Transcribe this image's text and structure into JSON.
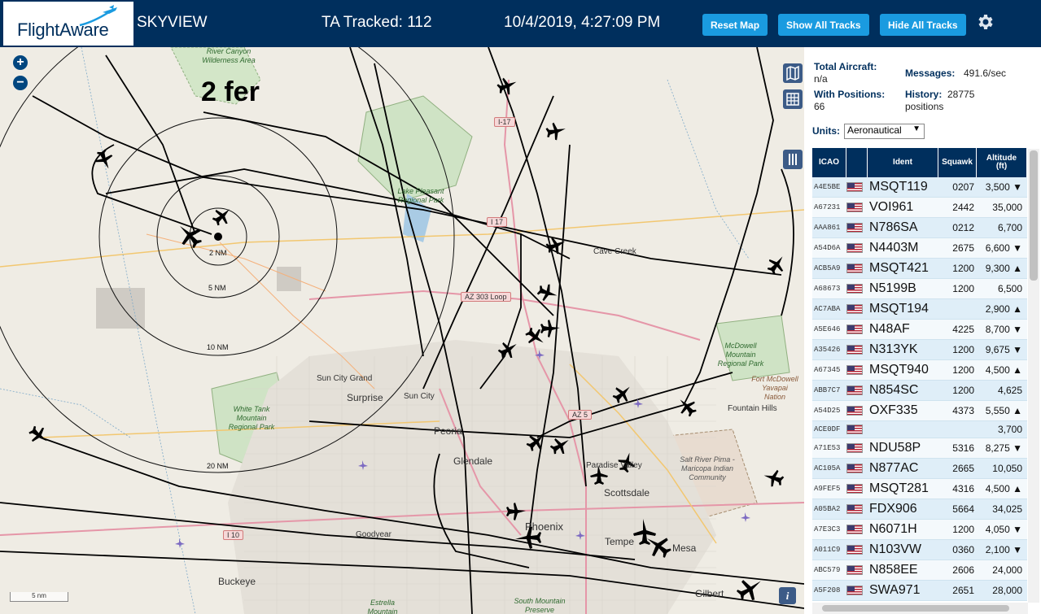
{
  "header": {
    "logo_text": "FlightAware",
    "app_name": "SKYVIEW",
    "tracked": "TA Tracked: 112",
    "clock": "10/4/2019, 4:27:09 PM",
    "buttons": {
      "reset_map": "Reset Map",
      "show_all": "Show All Tracks",
      "hide_all": "Hide All Tracks"
    }
  },
  "map": {
    "note": "2 fer",
    "zoom_in": "+",
    "zoom_out": "−",
    "scale": "5 nm",
    "info": "i",
    "ring_labels": [
      "2 NM",
      "5 NM",
      "10 NM",
      "20 NM"
    ],
    "place_labels": [
      "Sun City Grand",
      "Surprise",
      "Sun City",
      "Peoria",
      "Glendale",
      "Goodyear",
      "Buckeye",
      "Phoenix",
      "Scottsdale",
      "Paradise Valley",
      "Tempe",
      "Mesa",
      "Gilbert",
      "Fountain Hills",
      "Cave Creek",
      "Fort McDowell Yavapai Nation"
    ],
    "park_labels": [
      "Lake Pleasant Regional Park",
      "White Tank Mountain Regional Park",
      "McDowell Mountain Regional Park",
      "Salt River Pima - Maricopa Indian Community",
      "River Canyon Wilderness Area",
      "Estrella Mountain",
      "South Mountain Preserve"
    ],
    "road_labels": [
      "I-17",
      "I 17",
      "AZ 303 Loop",
      "AZ 5",
      "I 10"
    ]
  },
  "stats": {
    "total_label": "Total Aircraft:",
    "total_value": "n/a",
    "positions_label": "With Positions:",
    "positions_value": "66",
    "messages_label": "Messages:",
    "messages_value": "491.6/sec",
    "history_label": "History:",
    "history_value": "28775 positions"
  },
  "units": {
    "label": "Units:",
    "selected": "Aeronautical"
  },
  "table": {
    "headers": {
      "icao": "ICAO",
      "ident": "Ident",
      "squawk": "Squawk",
      "altitude": "Altitude (ft)"
    },
    "rows": [
      {
        "icao": "A4E5BE",
        "ident": "MSQT119",
        "squawk": "0207",
        "alt": "3,500 ▼"
      },
      {
        "icao": "A67231",
        "ident": "VOI961",
        "squawk": "2442",
        "alt": "35,000"
      },
      {
        "icao": "AAA861",
        "ident": "N786SA",
        "squawk": "0212",
        "alt": "6,700"
      },
      {
        "icao": "A54D6A",
        "ident": "N4403M",
        "squawk": "2675",
        "alt": "6,600 ▼"
      },
      {
        "icao": "ACB5A9",
        "ident": "MSQT421",
        "squawk": "1200",
        "alt": "9,300 ▲"
      },
      {
        "icao": "A68673",
        "ident": "N5199B",
        "squawk": "1200",
        "alt": "6,500"
      },
      {
        "icao": "AC7ABA",
        "ident": "MSQT194",
        "squawk": "",
        "alt": "2,900 ▲"
      },
      {
        "icao": "A5E646",
        "ident": "N48AF",
        "squawk": "4225",
        "alt": "8,700 ▼"
      },
      {
        "icao": "A35426",
        "ident": "N313YK",
        "squawk": "1200",
        "alt": "9,675 ▼"
      },
      {
        "icao": "A67345",
        "ident": "MSQT940",
        "squawk": "1200",
        "alt": "4,500 ▲"
      },
      {
        "icao": "ABB7C7",
        "ident": "N854SC",
        "squawk": "1200",
        "alt": "4,625"
      },
      {
        "icao": "A54D25",
        "ident": "OXF335",
        "squawk": "4373",
        "alt": "5,550 ▲"
      },
      {
        "icao": "ACE0DF",
        "ident": "",
        "squawk": "",
        "alt": "3,700"
      },
      {
        "icao": "A71E53",
        "ident": "NDU58P",
        "squawk": "5316",
        "alt": "8,275 ▼"
      },
      {
        "icao": "AC105A",
        "ident": "N877AC",
        "squawk": "2665",
        "alt": "10,050"
      },
      {
        "icao": "A9FEF5",
        "ident": "MSQT281",
        "squawk": "4316",
        "alt": "4,500 ▲"
      },
      {
        "icao": "A05BA2",
        "ident": "FDX906",
        "squawk": "5664",
        "alt": "34,025"
      },
      {
        "icao": "A7E3C3",
        "ident": "N6071H",
        "squawk": "1200",
        "alt": "4,050 ▼"
      },
      {
        "icao": "A011C9",
        "ident": "N103VW",
        "squawk": "0360",
        "alt": "2,100 ▼"
      },
      {
        "icao": "ABC579",
        "ident": "N858EE",
        "squawk": "2606",
        "alt": "24,000"
      },
      {
        "icao": "A5F208",
        "ident": "SWA971",
        "squawk": "2651",
        "alt": "28,000"
      }
    ]
  },
  "colors": {
    "header_bg": "#002f5d",
    "button_bg": "#1a9be0",
    "row_alt": "#dfeef8"
  }
}
